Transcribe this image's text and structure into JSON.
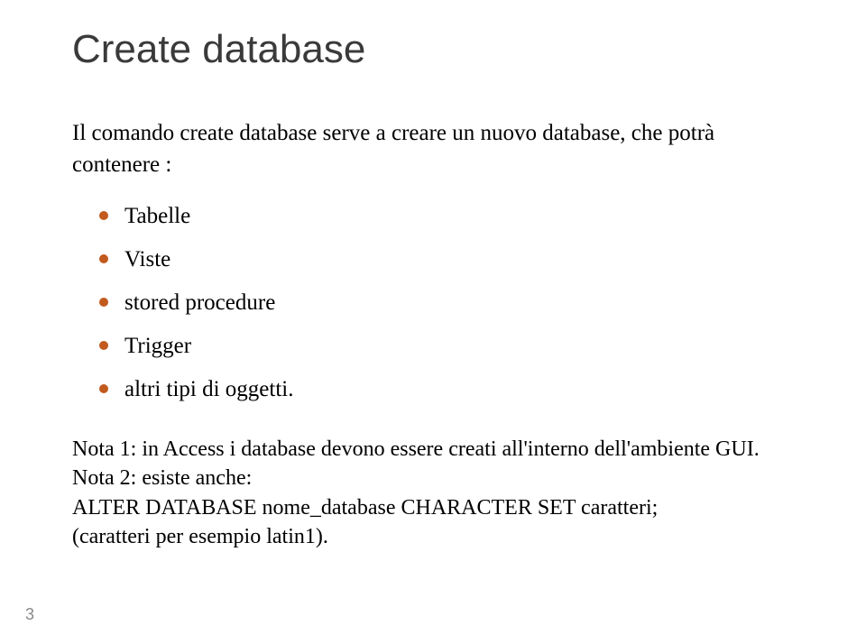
{
  "title": "Create database",
  "intro": "Il comando create database serve a creare un nuovo database, che potrà contenere :",
  "bullets": [
    "Tabelle",
    "Viste",
    "stored procedure",
    "Trigger",
    "altri tipi di oggetti."
  ],
  "notes": {
    "line1": "Nota 1: in Access i database devono essere creati all'interno dell'ambiente GUI.",
    "line2": "Nota 2: esiste anche:",
    "line3": "ALTER DATABASE nome_database CHARACTER SET caratteri;",
    "line4": "(caratteri per esempio latin1)."
  },
  "pageNumber": "3"
}
